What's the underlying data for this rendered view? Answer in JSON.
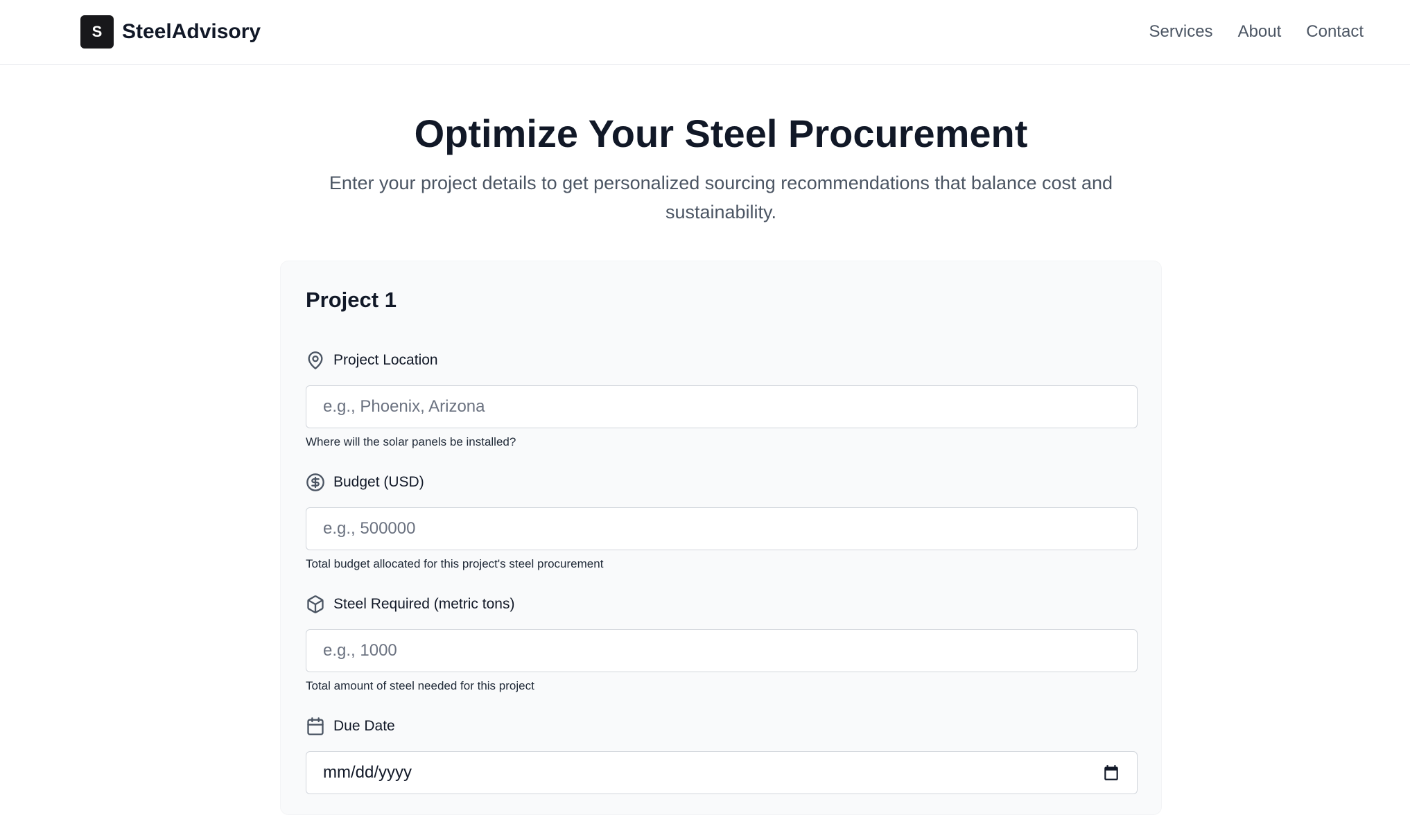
{
  "header": {
    "logo_letter": "S",
    "brand": "SteelAdvisory",
    "nav": [
      "Services",
      "About",
      "Contact"
    ]
  },
  "hero": {
    "title": "Optimize Your Steel Procurement",
    "subtitle": "Enter your project details to get personalized sourcing recommendations that balance cost and sustainability."
  },
  "project": {
    "title": "Project 1",
    "location": {
      "icon": "map-pin-icon",
      "label": "Project Location",
      "placeholder": "e.g., Phoenix, Arizona",
      "help": "Where will the solar panels be installed?"
    },
    "budget": {
      "icon": "dollar-circle-icon",
      "label": "Budget (USD)",
      "placeholder": "e.g., 500000",
      "help": "Total budget allocated for this project's steel procurement"
    },
    "steel": {
      "icon": "box-icon",
      "label": "Steel Required (metric tons)",
      "placeholder": "e.g., 1000",
      "help": "Total amount of steel needed for this project"
    },
    "due_date": {
      "icon": "calendar-icon",
      "label": "Due Date",
      "value": "mm/dd/yyyy"
    }
  },
  "colors": {
    "text_primary": "#111827",
    "text_secondary": "#4b5563",
    "card_bg": "#f9fafb",
    "logo_bg": "#18181b"
  }
}
